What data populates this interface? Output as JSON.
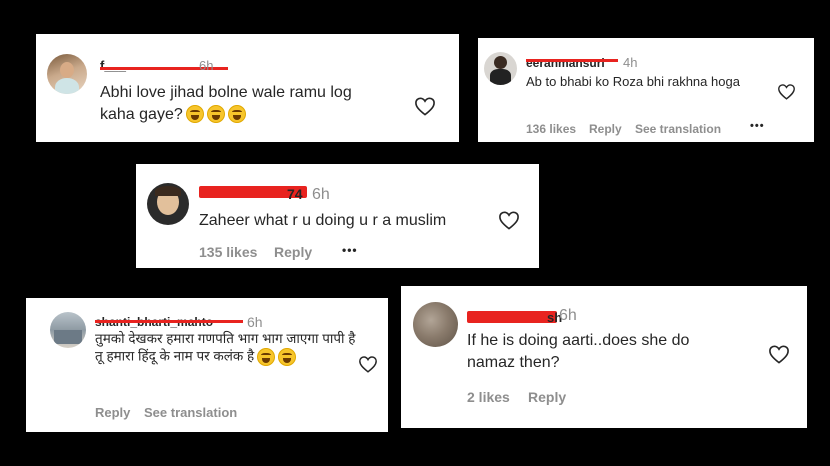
{
  "comments": [
    {
      "username_visible": "f___",
      "time": "6h",
      "text": "Abhi love jihad bolne wale ramu log kaha gaye?",
      "emoji_count": 3
    },
    {
      "username": "eeranmansuri",
      "time": "4h",
      "text": "Ab to bhabi ko Roza bhi rakhna hoga",
      "likes": "136 likes",
      "reply": "Reply",
      "see_translation": "See translation",
      "more": "•••"
    },
    {
      "username_visible": "74",
      "time": "6h",
      "text": "Zaheer what r u doing u r a muslim",
      "likes": "135 likes",
      "reply": "Reply",
      "more": "•••"
    },
    {
      "username": "shanti_bharti_mahto",
      "time": "6h",
      "text": "तुमको देखकर हमारा गणपति भाग भाग जाएगा पापी है तू हमारा हिंदू के नाम पर कलंक है",
      "emoji_count": 2,
      "reply": "Reply",
      "see_translation": "See translation"
    },
    {
      "username_visible": "sh",
      "time": "6h",
      "text": "If he is doing aarti..does she do namaz then?",
      "likes": "2 likes",
      "reply": "Reply"
    }
  ],
  "colors": {
    "redaction": "#e8231f",
    "muted": "#8e8e8e",
    "text": "#262626"
  },
  "icons": [
    "heart-icon",
    "laughing-emoji-icon",
    "more-options-icon"
  ]
}
